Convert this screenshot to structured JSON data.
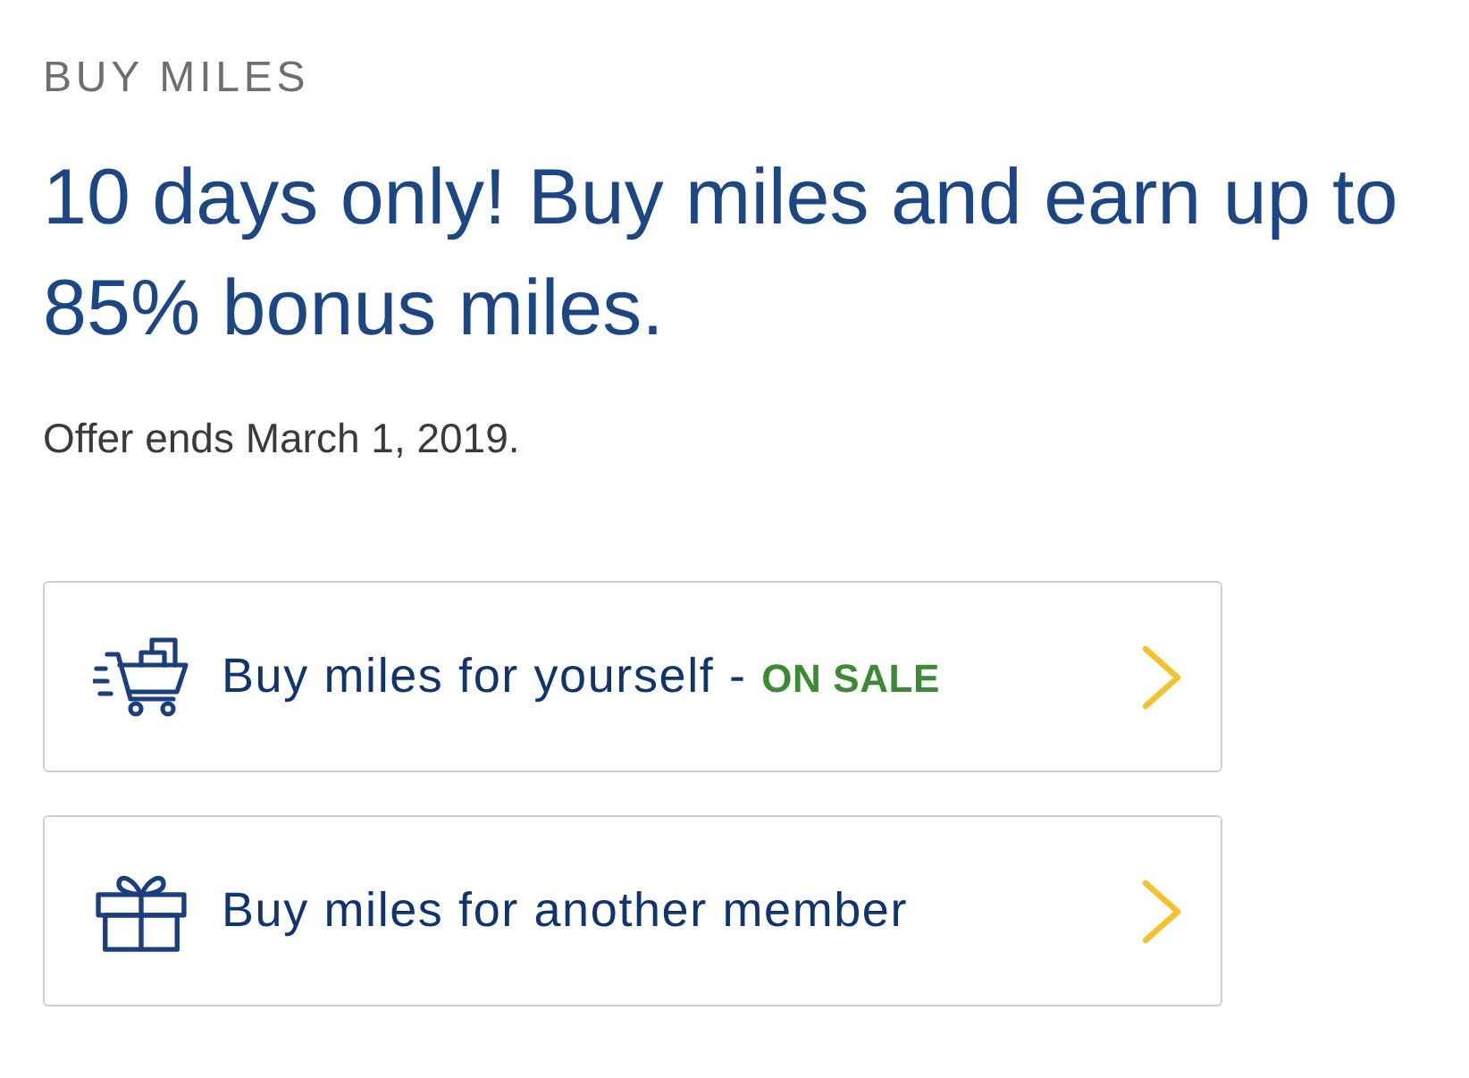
{
  "section_label": "BUY MILES",
  "headline": "10 days only! Buy miles and earn up to 85% bonus miles.",
  "offer_note": "Offer ends March 1, 2019.",
  "options": [
    {
      "kind": "cart",
      "label": "Buy miles for yourself -",
      "sale_tag": "ON SALE"
    },
    {
      "kind": "gift",
      "label": "Buy miles for another member"
    }
  ]
}
